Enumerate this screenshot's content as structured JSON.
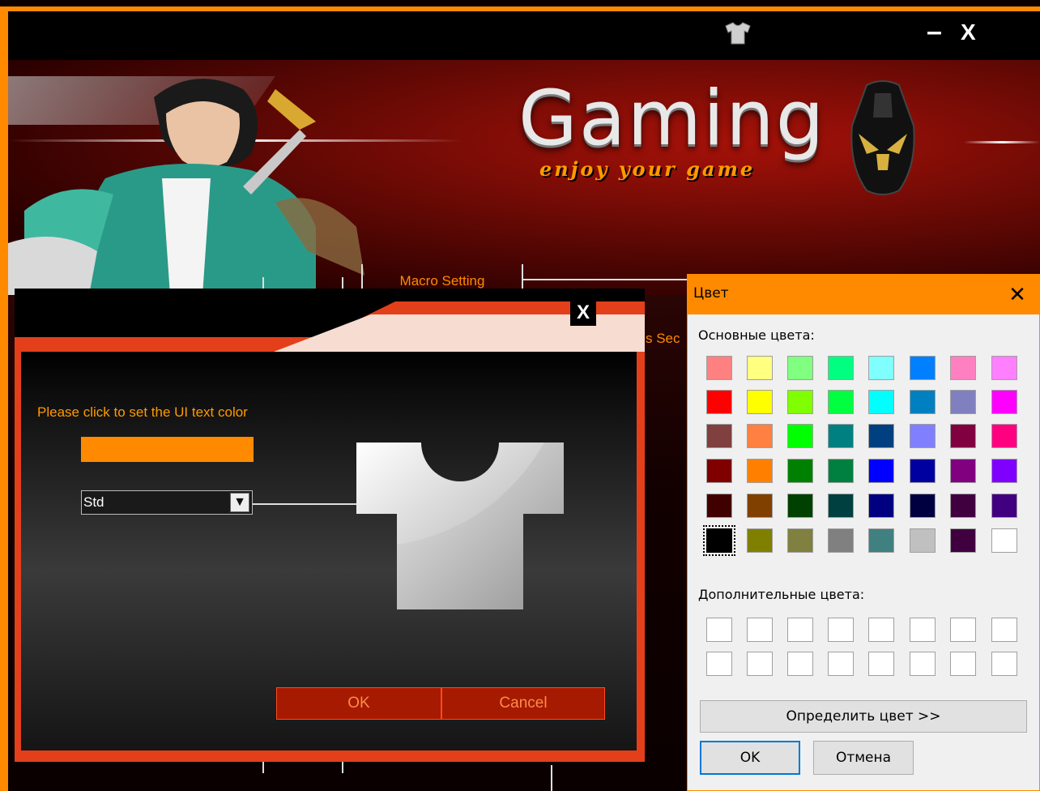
{
  "window": {
    "minimize_glyph": "–",
    "close_glyph": "X",
    "theme_icon": "tshirt-icon"
  },
  "banner": {
    "title": "Gaming",
    "subtitle": "enjoy your game"
  },
  "tabs": {
    "macro_setting": "Macro Setting",
    "partial_tab_text": "s Sec"
  },
  "color_dialog": {
    "close_glyph": "X",
    "prompt": "Please click to set the UI text color",
    "current_color": "#ff8a00",
    "style_select_value": "Std",
    "style_select_arrow": "▼",
    "ok_label": "OK",
    "cancel_label": "Cancel"
  },
  "picker": {
    "title": "Цвет",
    "close_glyph": "✕",
    "basic_colors_label": "Основные цвета:",
    "custom_colors_label": "Дополнительные цвета:",
    "define_button": "Определить цвет >>",
    "ok_label": "OK",
    "cancel_label": "Отмена",
    "selected_color": "#000000",
    "basic_colors": [
      [
        "#ff8080",
        "#ffff80",
        "#80ff80",
        "#00ff80",
        "#80ffff",
        "#0080ff",
        "#ff80c0",
        "#ff80ff"
      ],
      [
        "#ff0000",
        "#ffff00",
        "#80ff00",
        "#00ff40",
        "#00ffff",
        "#0080c0",
        "#8080c0",
        "#ff00ff"
      ],
      [
        "#804040",
        "#ff8040",
        "#00ff00",
        "#008080",
        "#004080",
        "#8080ff",
        "#800040",
        "#ff0080"
      ],
      [
        "#800000",
        "#ff8000",
        "#008000",
        "#008040",
        "#0000ff",
        "#0000a0",
        "#800080",
        "#8000ff"
      ],
      [
        "#400000",
        "#804000",
        "#004000",
        "#004040",
        "#000080",
        "#000040",
        "#400040",
        "#400080"
      ],
      [
        "#000000",
        "#808000",
        "#808040",
        "#808080",
        "#408080",
        "#c0c0c0",
        "#400040",
        "#ffffff"
      ]
    ],
    "custom_colors": [
      [
        "#ffffff",
        "#ffffff",
        "#ffffff",
        "#ffffff",
        "#ffffff",
        "#ffffff",
        "#ffffff",
        "#ffffff"
      ],
      [
        "#ffffff",
        "#ffffff",
        "#ffffff",
        "#ffffff",
        "#ffffff",
        "#ffffff",
        "#ffffff",
        "#ffffff"
      ]
    ]
  }
}
